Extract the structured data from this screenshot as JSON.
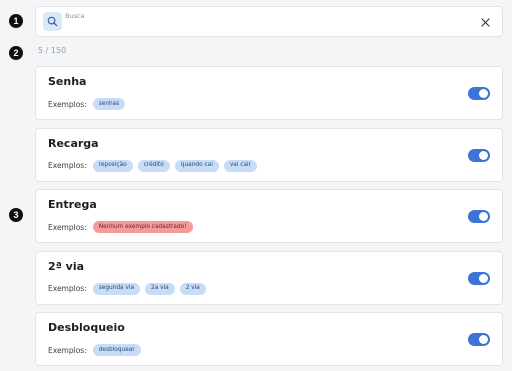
{
  "steps": [
    "1",
    "2",
    "3"
  ],
  "search": {
    "label": "Busca",
    "value": "",
    "placeholder": ""
  },
  "counter": "5 / 150",
  "examples_label": "Exemplos:",
  "items": [
    {
      "title": "Senha",
      "tags": [
        "senhas"
      ],
      "empty": false,
      "enabled": true
    },
    {
      "title": "Recarga",
      "tags": [
        "reposição",
        "crédito",
        "quando cai",
        "vai cair"
      ],
      "empty": false,
      "enabled": true
    },
    {
      "title": "Entrega",
      "tags": [
        "Nenhum exemplo cadastrado!"
      ],
      "empty": true,
      "enabled": true
    },
    {
      "title": "2ª via",
      "tags": [
        "segunda via",
        "2a via",
        "2 via"
      ],
      "empty": false,
      "enabled": true
    },
    {
      "title": "Desbloqueio",
      "tags": [
        "desbloquear"
      ],
      "empty": false,
      "enabled": true
    }
  ],
  "colors": {
    "accent": "#3b74d6",
    "tag": "#c6dcf8",
    "tag_empty": "#f59b9b",
    "badge": "#0f0f0f"
  },
  "icons": {
    "search": "search-icon",
    "clear": "close-icon",
    "toggle": "toggle-switch"
  }
}
